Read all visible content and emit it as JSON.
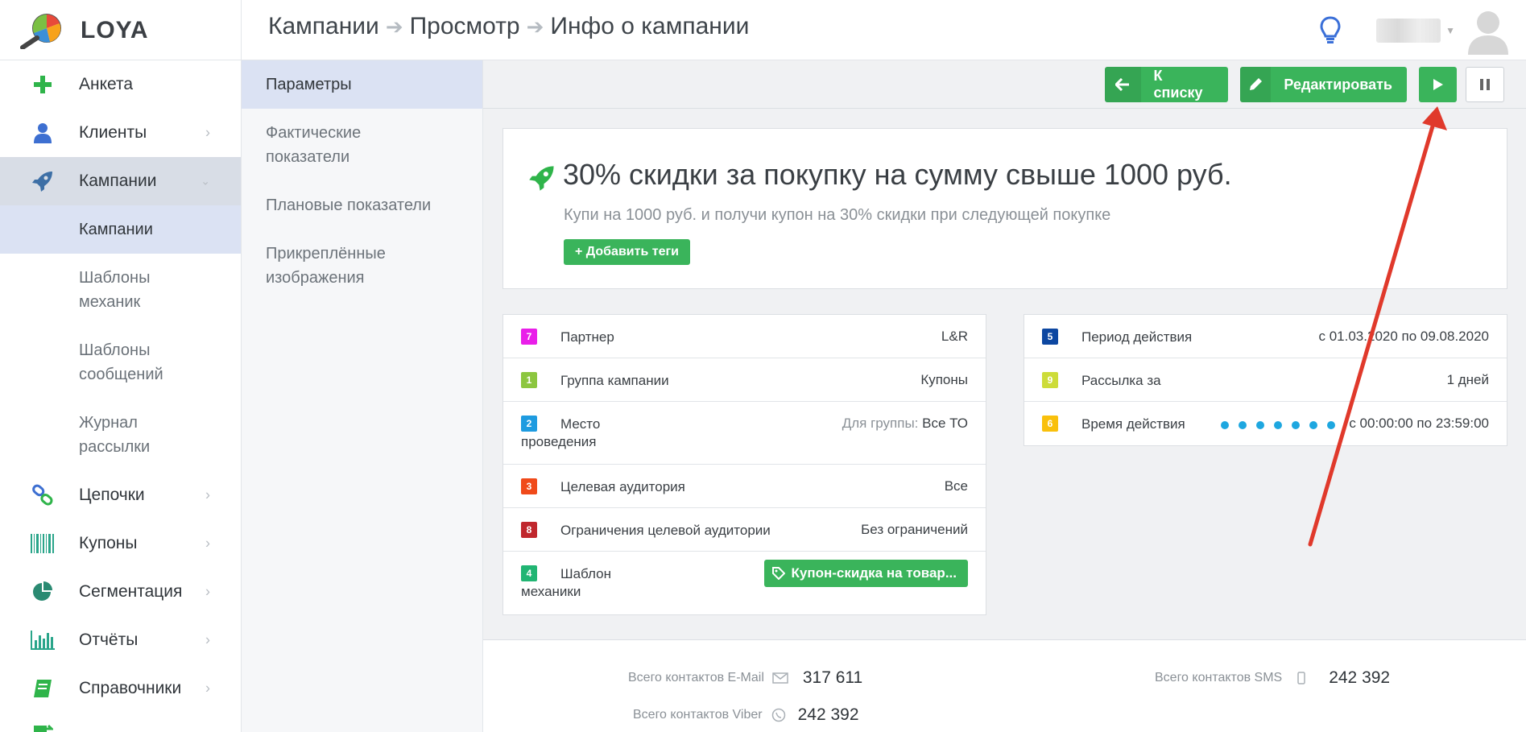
{
  "app": {
    "logo_text": "LOYA"
  },
  "breadcrumb": [
    "Кампании",
    "Просмотр",
    "Инфо о кампании"
  ],
  "sidebar": {
    "items": [
      {
        "label": "Анкета"
      },
      {
        "label": "Клиенты"
      },
      {
        "label": "Кампании"
      },
      {
        "label": "Цепочки"
      },
      {
        "label": "Купоны"
      },
      {
        "label": "Сегментация"
      },
      {
        "label": "Отчёты"
      },
      {
        "label": "Справочники"
      }
    ],
    "sub_items": [
      {
        "label": "Кампании"
      },
      {
        "label": "Шаблоны механик"
      },
      {
        "label": "Шаблоны сообщений"
      },
      {
        "label": "Журнал рассылки"
      }
    ]
  },
  "tabs": [
    {
      "label": "Параметры"
    },
    {
      "label": "Фактические показатели"
    },
    {
      "label": "Плановые показатели"
    },
    {
      "label": "Прикреплённые изображения"
    }
  ],
  "toolbar": {
    "back_label": "К списку",
    "edit_label": "Редактировать"
  },
  "campaign": {
    "title": "30% скидки за покупку на сумму свыше 1000 руб.",
    "subtitle": "Купи на 1000 руб. и получи купон на 30% скидки при следующей покупке",
    "add_tags_label": "+ Добавить теги"
  },
  "left_params": [
    {
      "badge": "7",
      "color": "#e91ee9",
      "label": "Партнер",
      "value": "L&R"
    },
    {
      "badge": "1",
      "color": "#8cc63f",
      "label": "Группа кампании",
      "value": "Купоны"
    },
    {
      "badge": "2",
      "color": "#1e9be0",
      "label": "Место проведения",
      "value_prefix": "Для группы:",
      "value": "Все ТО"
    },
    {
      "badge": "3",
      "color": "#f04a1a",
      "label": "Целевая аудитория",
      "value": "Все"
    },
    {
      "badge": "8",
      "color": "#c0272d",
      "label": "Ограничения целевой аудитории",
      "value": "Без ограничений"
    },
    {
      "badge": "4",
      "color": "#21b573",
      "label": "Шаблон механики",
      "value": "Купон-скидка на товар..."
    }
  ],
  "right_params": [
    {
      "badge": "5",
      "color": "#0d47a1",
      "label": "Период действия",
      "value": "с 01.03.2020 по 09.08.2020"
    },
    {
      "badge": "9",
      "color": "#cddc39",
      "label": "Рассылка за",
      "value": "1 дней"
    },
    {
      "badge": "6",
      "color": "#f9c00c",
      "label": "Время действия",
      "value": "с 00:00:00 по 23:59:00"
    }
  ],
  "stats": {
    "email_label": "Всего контактов E-Mail",
    "email_value": "317 611",
    "sms_label": "Всего контактов SMS",
    "sms_value": "242 392",
    "viber_label": "Всего контактов Viber",
    "viber_value": "242 392"
  },
  "colors": {
    "accent_green": "#3ab45b",
    "annotation_arrow": "#e0392b"
  }
}
